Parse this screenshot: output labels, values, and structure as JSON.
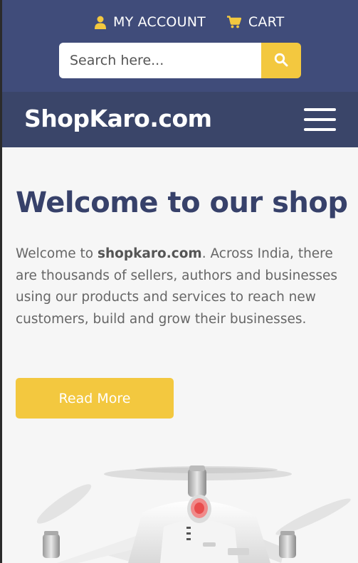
{
  "header": {
    "account_label": "MY ACCOUNT",
    "cart_label": "CART",
    "search_placeholder": "Search here...",
    "account_icon": "user-icon",
    "cart_icon": "cart-icon",
    "search_icon": "search-icon"
  },
  "nav": {
    "brand": "ShopKaro.com",
    "menu_icon": "hamburger-menu-icon"
  },
  "hero": {
    "title": "Welcome to our shop",
    "text_prefix": "Welcome to ",
    "text_bold": "shopkaro.com",
    "text_suffix": ". Across India, there are thousands of sellers, authors and businesses using our products and services to reach new customers, build and grow their businesses.",
    "button_label": "Read More",
    "image": "drone-image"
  },
  "colors": {
    "topbar": "#404c7a",
    "navbar": "#3a4569",
    "accent": "#f3c83f",
    "title": "#37416a",
    "text": "#666666",
    "background": "#f6f6f6"
  }
}
